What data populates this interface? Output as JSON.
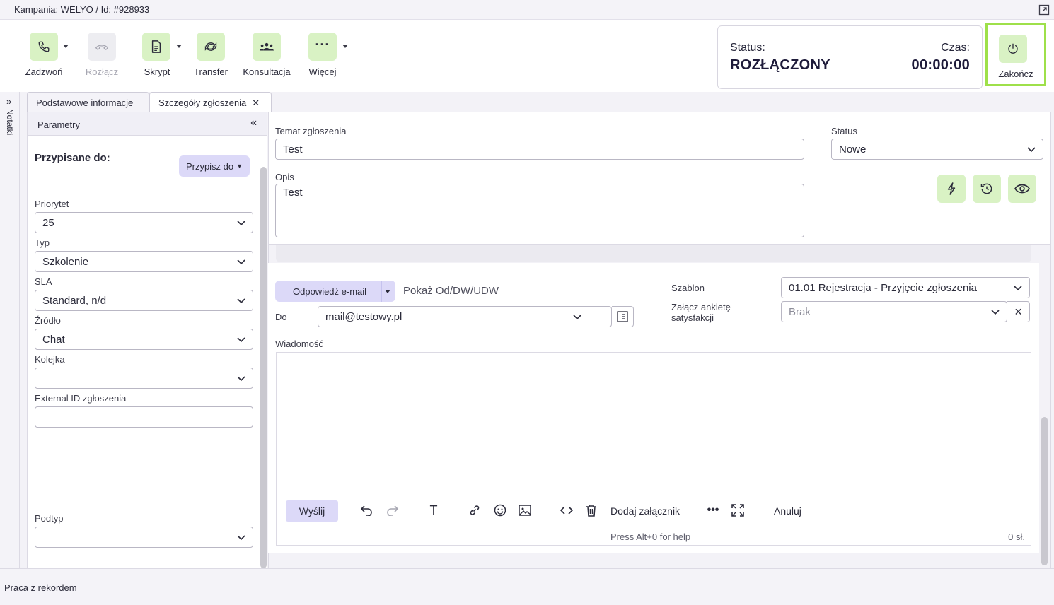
{
  "topbar": {
    "title": "Kampania: WELYO / Id: #928933"
  },
  "toolbar": {
    "buttons": [
      {
        "label": "Zadzwoń",
        "icon": "phone-icon",
        "enabled": true,
        "has_menu": true
      },
      {
        "label": "Rozłącz",
        "icon": "hangup-icon",
        "enabled": false,
        "has_menu": false
      },
      {
        "label": "Skrypt",
        "icon": "document-icon",
        "enabled": true,
        "has_menu": true
      },
      {
        "label": "Transfer",
        "icon": "transfer-icon",
        "enabled": true,
        "has_menu": false
      },
      {
        "label": "Konsultacja",
        "icon": "people-icon",
        "enabled": true,
        "has_menu": false
      },
      {
        "label": "Więcej",
        "icon": "more-icon",
        "enabled": true,
        "has_menu": true
      }
    ],
    "status_label": "Status:",
    "status_value": "ROZŁĄCZONY",
    "time_label": "Czas:",
    "time_value": "00:00:00",
    "end_label": "Zakończ"
  },
  "notes": {
    "label": "Notatki"
  },
  "tabs": [
    {
      "label": "Podstawowe informacje",
      "active": false
    },
    {
      "label": "Szczegóły zgłoszenia",
      "active": true,
      "closable": true
    }
  ],
  "left_panel": {
    "header": "Parametry",
    "assigned_label": "Przypisane do:",
    "assign_button": "Przypisz do",
    "fields": {
      "priority": {
        "label": "Priorytet",
        "value": "25"
      },
      "type": {
        "label": "Typ",
        "value": "Szkolenie"
      },
      "sla": {
        "label": "SLA",
        "value": "Standard, n/d"
      },
      "source": {
        "label": "Źródło",
        "value": "Chat"
      },
      "queue": {
        "label": "Kolejka",
        "value": ""
      },
      "external_id": {
        "label": "External ID zgłoszenia",
        "value": ""
      },
      "subtype": {
        "label": "Podtyp",
        "value": ""
      }
    }
  },
  "ticket": {
    "subject_label": "Temat zgłoszenia",
    "subject_value": "Test",
    "status_label": "Status",
    "status_value": "Nowe",
    "description_label": "Opis",
    "description_value": "Test",
    "action_icons": [
      "lightning-icon",
      "history-icon",
      "eye-icon"
    ]
  },
  "email": {
    "reply_button": "Odpowiedź e-mail",
    "show_link": "Pokaż Od/DW/UDW",
    "to_label": "Do",
    "to_value": "mail@testowy.pl",
    "template_label": "Szablon",
    "template_value": "01.01 Rejestracja - Przyjęcie zgłoszenia",
    "survey_label_1": "Załącz ankietę",
    "survey_label_2": "satysfakcji",
    "survey_value": "Brak",
    "message_label": "Wiadomość",
    "send_button": "Wyślij",
    "add_attachment": "Dodaj załącznik",
    "cancel": "Anuluj",
    "help_text": "Press Alt+0 for help",
    "word_count": "0 sł."
  },
  "bottombar": {
    "label": "Praca z rekordem"
  },
  "colors": {
    "accent_green": "#d9f2c4",
    "highlight": "#9ee04a",
    "accent_purple": "#dcd9f8"
  }
}
